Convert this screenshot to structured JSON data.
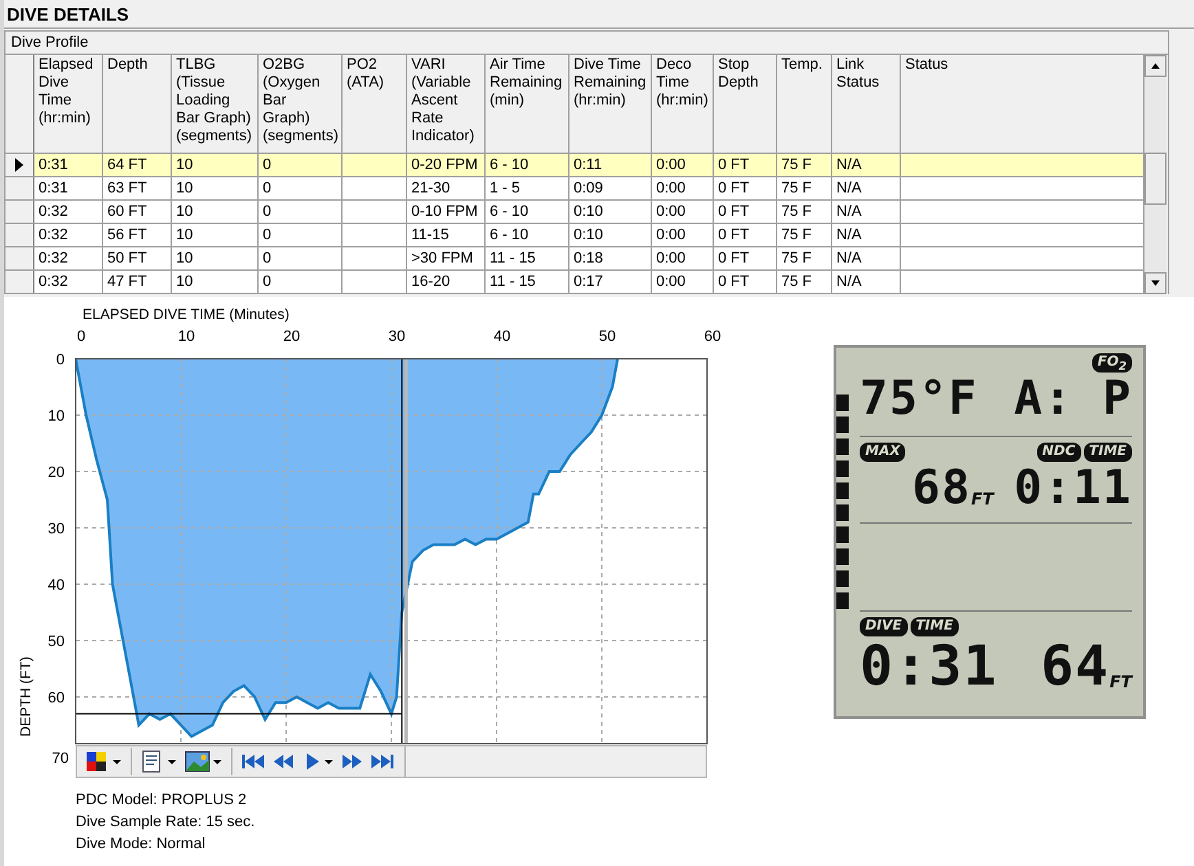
{
  "header": {
    "title": "DIVE DETAILS"
  },
  "profile_table": {
    "title": "Dive Profile",
    "columns": [
      "Elapsed Dive Time (hr:min)",
      "Depth",
      "TLBG (Tissue Loading Bar Graph) (segments)",
      "O2BG (Oxygen Bar Graph) (segments)",
      "PO2 (ATA)",
      "VARI (Variable Ascent Rate Indicator)",
      "Air Time Remaining (min)",
      "Dive Time Remaining (hr:min)",
      "Deco Time (hr:min)",
      "Stop Depth",
      "Temp.",
      "Link Status",
      "Status"
    ],
    "rows": [
      {
        "selected": true,
        "cells": [
          "0:31",
          "64 FT",
          "10",
          "0",
          null,
          "0-20 FPM",
          "6 - 10",
          "0:11",
          "0:00",
          "0 FT",
          "75 F",
          "N/A",
          null
        ]
      },
      {
        "selected": false,
        "cells": [
          "0:31",
          "63 FT",
          "10",
          "0",
          null,
          "21-30",
          "1 - 5",
          "0:09",
          "0:00",
          "0 FT",
          "75 F",
          "N/A",
          null
        ]
      },
      {
        "selected": false,
        "cells": [
          "0:32",
          "60 FT",
          "10",
          "0",
          null,
          "0-10 FPM",
          "6 - 10",
          "0:10",
          "0:00",
          "0 FT",
          "75 F",
          "N/A",
          null
        ]
      },
      {
        "selected": false,
        "cells": [
          "0:32",
          "56 FT",
          "10",
          "0",
          null,
          "11-15",
          "6 - 10",
          "0:10",
          "0:00",
          "0 FT",
          "75 F",
          "N/A",
          null
        ]
      },
      {
        "selected": false,
        "cells": [
          "0:32",
          "50 FT",
          "10",
          "0",
          null,
          ">30 FPM",
          "11 - 15",
          "0:18",
          "0:00",
          "0 FT",
          "75 F",
          "N/A",
          null
        ]
      },
      {
        "selected": false,
        "cells": [
          "0:32",
          "47 FT",
          "10",
          "0",
          null,
          "16-20",
          "11 - 15",
          "0:17",
          "0:00",
          "0 FT",
          "75 F",
          "N/A",
          null
        ]
      }
    ]
  },
  "chart": {
    "chart_data": {
      "type": "area",
      "xlabel": "ELAPSED DIVE TIME (Minutes)",
      "ylabel": "DEPTH (FT)",
      "x": [
        0,
        1,
        2,
        3,
        3.5,
        4,
        5,
        6,
        7,
        8,
        9,
        10,
        11,
        12,
        13,
        14,
        15,
        16,
        17,
        18,
        19,
        20,
        21,
        22,
        23,
        24,
        25,
        26,
        27,
        28,
        29,
        30,
        30.5,
        31,
        32,
        33,
        34,
        35,
        36,
        37,
        38,
        39,
        40,
        41,
        42,
        43,
        43.5,
        44,
        45,
        46,
        47,
        48,
        49,
        50,
        51,
        51.5
      ],
      "series": [
        {
          "color": "#1a7fc4",
          "values": [
            0,
            10,
            18,
            25,
            40,
            45,
            55,
            65,
            63,
            64,
            63,
            65,
            67,
            66,
            65,
            61,
            59,
            58,
            60,
            64,
            61,
            61,
            60,
            61,
            62,
            61,
            62,
            62,
            62,
            56,
            59,
            63,
            60,
            45,
            36,
            34,
            33,
            33,
            33,
            32,
            33,
            32,
            32,
            31,
            30,
            29,
            24,
            24,
            20,
            20,
            17,
            15,
            13,
            10,
            5,
            0
          ]
        }
      ],
      "xlim": [
        0,
        60
      ],
      "ylim": [
        70,
        0
      ],
      "xticks": [
        0,
        10,
        20,
        30,
        40,
        50,
        60
      ],
      "yticks": [
        0,
        10,
        20,
        30,
        40,
        50,
        60,
        70
      ],
      "grid": true,
      "ref_lines": [
        {
          "axis": "x",
          "value": 31.4,
          "color": "#b8b8b8"
        },
        {
          "axis": "x",
          "value": 31,
          "color": "#000000"
        },
        {
          "axis": "y",
          "value": 63,
          "color": "#000000"
        }
      ]
    }
  },
  "info": [
    "PDC Model: PROPLUS 2",
    "Dive Sample Rate: 15 sec.",
    "Dive Mode: Normal"
  ],
  "dive_computer": {
    "bar_graph": {
      "level": 1
    },
    "fo2_label": "FO$_{2}$",
    "temperature": "75°F",
    "gas": "A: P",
    "max_label": "MAX",
    "max_depth": "68",
    "max_unit": "FT",
    "ndc_label": "NDC",
    "ndc_time_label": "TIME",
    "ndc_time": "0:11",
    "dive_label": "DIVE",
    "dive_time_label": "TIME",
    "dive_time": "0:31",
    "depth": "64",
    "depth_unit": "FT"
  }
}
